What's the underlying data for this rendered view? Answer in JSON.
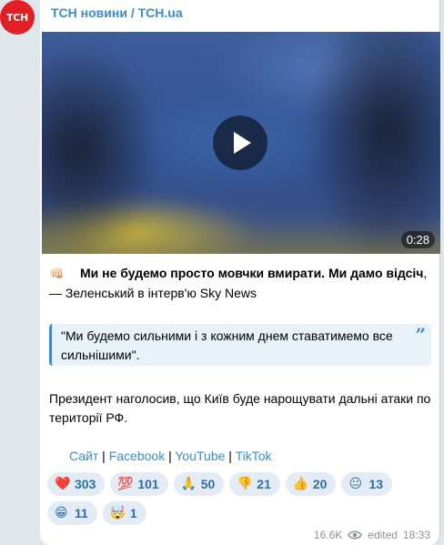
{
  "channel": {
    "avatar_text": "ТСН",
    "name": "ТСН новини / TCH.ua"
  },
  "video": {
    "duration": "0:28"
  },
  "post": {
    "headline_emoji": "👊🏻",
    "headline_bold": "Ми не будемо просто мовчки вмирати. Ми дамо відсіч",
    "headline_rest": ", — Зеленський в інтерв'ю Sky News",
    "quote": "\"Ми будемо сильними і з кожним днем ставатимемо все сильнішими\".",
    "quote_icon": "”",
    "paragraph": "Президент наголосив, що Київ буде нарощувати дальні атаки по території РФ.",
    "links": [
      "Сайт",
      "Facebook",
      "YouTube",
      "TikTok"
    ],
    "link_separator": " | "
  },
  "reactions": [
    {
      "emoji": "❤️",
      "count": "303"
    },
    {
      "emoji": "💯",
      "count": "101"
    },
    {
      "emoji": "🙏",
      "count": "50"
    },
    {
      "emoji": "👎",
      "count": "21"
    },
    {
      "emoji": "👍",
      "count": "20"
    },
    {
      "emoji": "😐",
      "count": "13"
    },
    {
      "emoji": "😁",
      "count": "11"
    },
    {
      "emoji": "🤯",
      "count": "1"
    }
  ],
  "meta": {
    "views": "16.6K",
    "edited_label": "edited",
    "time": "18:33"
  },
  "colors": {
    "accent": "#3a8bd2",
    "avatar_bg": "#e31e24",
    "background": "#dfe7ea"
  }
}
